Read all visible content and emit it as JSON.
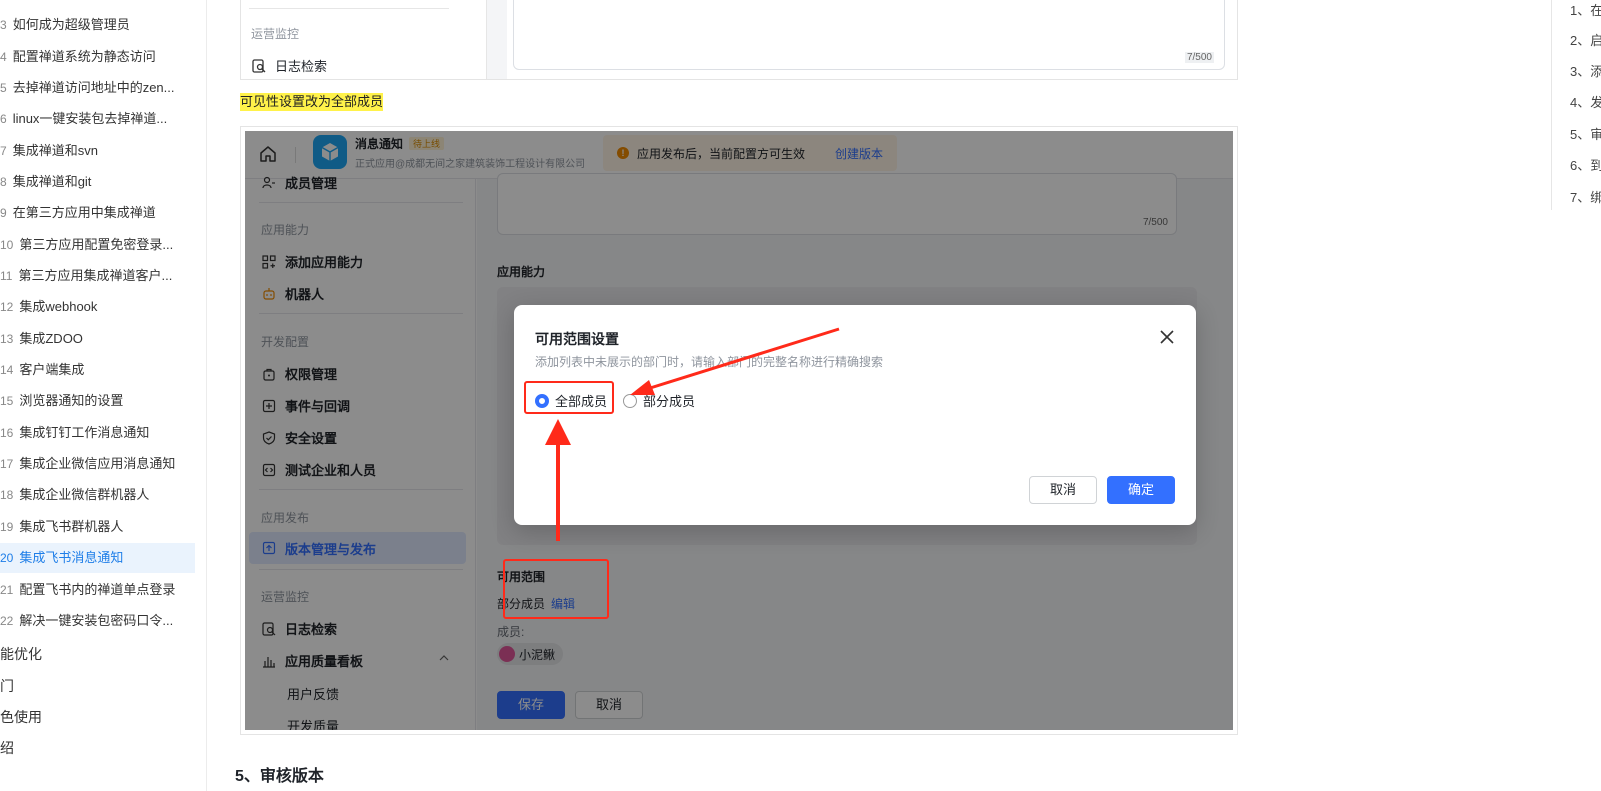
{
  "left_nav": {
    "items": [
      {
        "num": "3",
        "label": "如何成为超级管理员"
      },
      {
        "num": "4",
        "label": "配置禅道系统为静态访问"
      },
      {
        "num": "5",
        "label": "去掉禅道访问地址中的zen..."
      },
      {
        "num": "6",
        "label": "linux一键安装包去掉禅道..."
      },
      {
        "num": "7",
        "label": "集成禅道和svn"
      },
      {
        "num": "8",
        "label": "集成禅道和git"
      },
      {
        "num": "9",
        "label": "在第三方应用中集成禅道"
      },
      {
        "num": "10",
        "label": "第三方应用配置免密登录..."
      },
      {
        "num": "11",
        "label": "第三方应用集成禅道客户..."
      },
      {
        "num": "12",
        "label": "集成webhook"
      },
      {
        "num": "13",
        "label": "集成ZDOO"
      },
      {
        "num": "14",
        "label": "客户端集成"
      },
      {
        "num": "15",
        "label": "浏览器通知的设置"
      },
      {
        "num": "16",
        "label": "集成钉钉工作消息通知"
      },
      {
        "num": "17",
        "label": "集成企业微信应用消息通知"
      },
      {
        "num": "18",
        "label": "集成企业微信群机器人"
      },
      {
        "num": "19",
        "label": "集成飞书群机器人"
      },
      {
        "num": "20",
        "label": "集成飞书消息通知",
        "active": true
      },
      {
        "num": "21",
        "label": "配置飞书内的禅道单点登录"
      },
      {
        "num": "22",
        "label": "解决一键安装包密码口令..."
      }
    ],
    "bottom_items": [
      "能优化",
      "门",
      "色使用",
      "绍"
    ]
  },
  "toc": {
    "items": [
      "1、在",
      "2、启",
      "3、添",
      "4、发",
      "5、审",
      "6、到",
      "7、绑"
    ]
  },
  "top_frame": {
    "section_label": "运营监控",
    "log_item": "日志检索",
    "counter": "7/500"
  },
  "highlight_text": "可见性设置改为全部成员",
  "screenshot": {
    "header": {
      "app_name": "消息通知",
      "badge": "待上线",
      "subtitle": "正式应用@成都无间之家建筑装饰工程设计有限公司",
      "notice": "应用发布后，当前配置方可生效",
      "create_version": "创建版本"
    },
    "sidebar": {
      "top_item": "成员管理",
      "sections": [
        {
          "title": "应用能力",
          "items": [
            "添加应用能力",
            "机器人"
          ]
        },
        {
          "title": "开发配置",
          "items": [
            "权限管理",
            "事件与回调",
            "安全设置",
            "测试企业和人员"
          ]
        },
        {
          "title": "应用发布",
          "items": [
            "版本管理与发布"
          ]
        },
        {
          "title": "运营监控",
          "items": [
            "日志检索",
            "应用质量看板"
          ]
        }
      ],
      "sub_items": [
        "用户反馈",
        "开发质量"
      ]
    },
    "main": {
      "counter": "7/500",
      "app_ability": "应用能力",
      "scope_title": "可用范围",
      "scope_value": "部分成员",
      "edit_link": "编辑",
      "members_label": "成员:",
      "member_name": "小泥鳅",
      "save": "保存",
      "cancel": "取消"
    },
    "modal": {
      "title": "可用范围设置",
      "desc": "添加列表中未展示的部门时，请输入部门的完整名称进行精确搜索",
      "option_all": "全部成员",
      "option_partial": "部分成员",
      "cancel": "取消",
      "confirm": "确定"
    }
  },
  "section_title": "5、审核版本",
  "colors": {
    "accent": "#3370ff",
    "highlight": "#fff24a",
    "annotation_red": "#ff2a1a",
    "nav_active": "#1e7ee8"
  }
}
